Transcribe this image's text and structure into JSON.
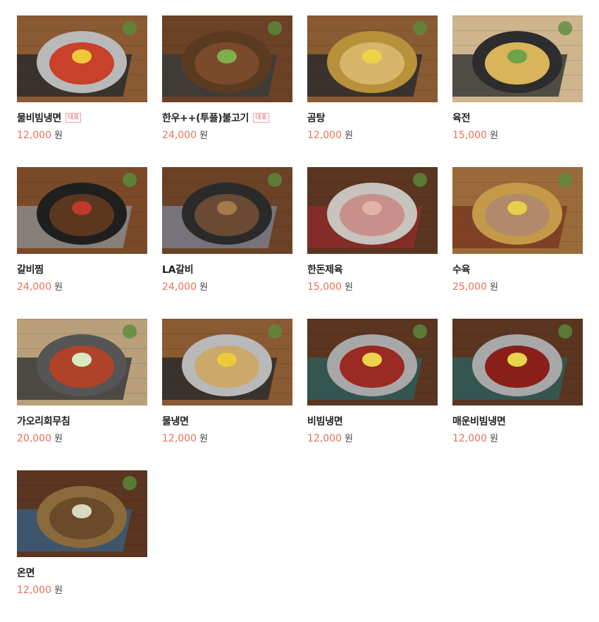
{
  "menu": {
    "currency_unit": "원",
    "items": [
      {
        "name": "물비빔냉면",
        "badge": "대표",
        "price": "12,000",
        "image": "bowl-red-noodles-wood",
        "colors": {
          "bg": "#8a5a33",
          "mat": "#2b2b2b",
          "bowl": "#b9b9b9",
          "food": "#c9412a",
          "top": "#f0c93a"
        }
      },
      {
        "name": "한우++(투플)불고기",
        "badge": "대표",
        "price": "24,000",
        "image": "bulgogi-hotpot-sides",
        "colors": {
          "bg": "#6b4226",
          "mat": "#3a3a3a",
          "bowl": "#5a3b22",
          "food": "#7a4a2a",
          "top": "#7fae4c"
        }
      },
      {
        "name": "곰탕",
        "badge": "",
        "price": "12,000",
        "image": "brass-bowl-soup",
        "colors": {
          "bg": "#8a5a33",
          "mat": "#2b2b2b",
          "bowl": "#b8913a",
          "food": "#d7b56a",
          "top": "#f0d24a"
        }
      },
      {
        "name": "육전",
        "badge": "",
        "price": "15,000",
        "image": "pancake-plate-table",
        "colors": {
          "bg": "#cfb58d",
          "mat": "#3a3a3a",
          "bowl": "#2d2d2d",
          "food": "#d9b45a",
          "top": "#6fa34a"
        }
      },
      {
        "name": "갈비찜",
        "badge": "",
        "price": "24,000",
        "image": "braised-ribs-pot",
        "colors": {
          "bg": "#7a4a28",
          "mat": "#888888",
          "bowl": "#1f1f1f",
          "food": "#5b3720",
          "top": "#c0392b"
        }
      },
      {
        "name": "LA갈비",
        "badge": "",
        "price": "24,000",
        "image": "ribs-hotplate",
        "colors": {
          "bg": "#6b4226",
          "mat": "#7a7a8a",
          "bowl": "#2a2a2a",
          "food": "#6a4a32",
          "top": "#a57a4a"
        }
      },
      {
        "name": "한돈제육",
        "badge": "",
        "price": "15,000",
        "image": "sliced-pork-plate",
        "colors": {
          "bg": "#5a3520",
          "mat": "#8b2a2a",
          "bowl": "#c7c3bd",
          "food": "#c98f8a",
          "top": "#e2b3a8"
        }
      },
      {
        "name": "수육",
        "badge": "",
        "price": "25,000",
        "image": "brass-plate-beef",
        "colors": {
          "bg": "#9a6a3a",
          "mat": "#7a3a20",
          "bowl": "#c49a4a",
          "food": "#b08a6a",
          "top": "#e6d04a"
        }
      },
      {
        "name": "가오리회무침",
        "badge": "",
        "price": "20,000",
        "image": "spicy-stingray-salad",
        "colors": {
          "bg": "#b9a07a",
          "mat": "#3a3a3a",
          "bowl": "#555555",
          "food": "#b0422a",
          "top": "#d9e8c0"
        }
      },
      {
        "name": "물냉면",
        "badge": "",
        "price": "12,000",
        "image": "cold-noodle-bowl",
        "colors": {
          "bg": "#8a5a33",
          "mat": "#2b2b2b",
          "bowl": "#b9b9b9",
          "food": "#caa96a",
          "top": "#f0c93a"
        }
      },
      {
        "name": "비빔냉면",
        "badge": "",
        "price": "12,000",
        "image": "spicy-noodle-silver-bowl",
        "colors": {
          "bg": "#5a3520",
          "mat": "#2f5a5a",
          "bowl": "#a8a8a8",
          "food": "#9a2a22",
          "top": "#f0d24a"
        }
      },
      {
        "name": "매운비빔냉면",
        "badge": "",
        "price": "12,000",
        "image": "hot-spicy-noodle-bowl",
        "colors": {
          "bg": "#5a3520",
          "mat": "#2f5a5a",
          "bowl": "#a8a8a8",
          "food": "#8a1f1a",
          "top": "#e8d44a"
        }
      },
      {
        "name": "온면",
        "badge": "",
        "price": "12,000",
        "image": "warm-noodle-brass-bowl",
        "colors": {
          "bg": "#5a3520",
          "mat": "#3a5a7a",
          "bowl": "#8a6a3a",
          "food": "#6a4a2a",
          "top": "#d9d9c0"
        }
      }
    ]
  }
}
